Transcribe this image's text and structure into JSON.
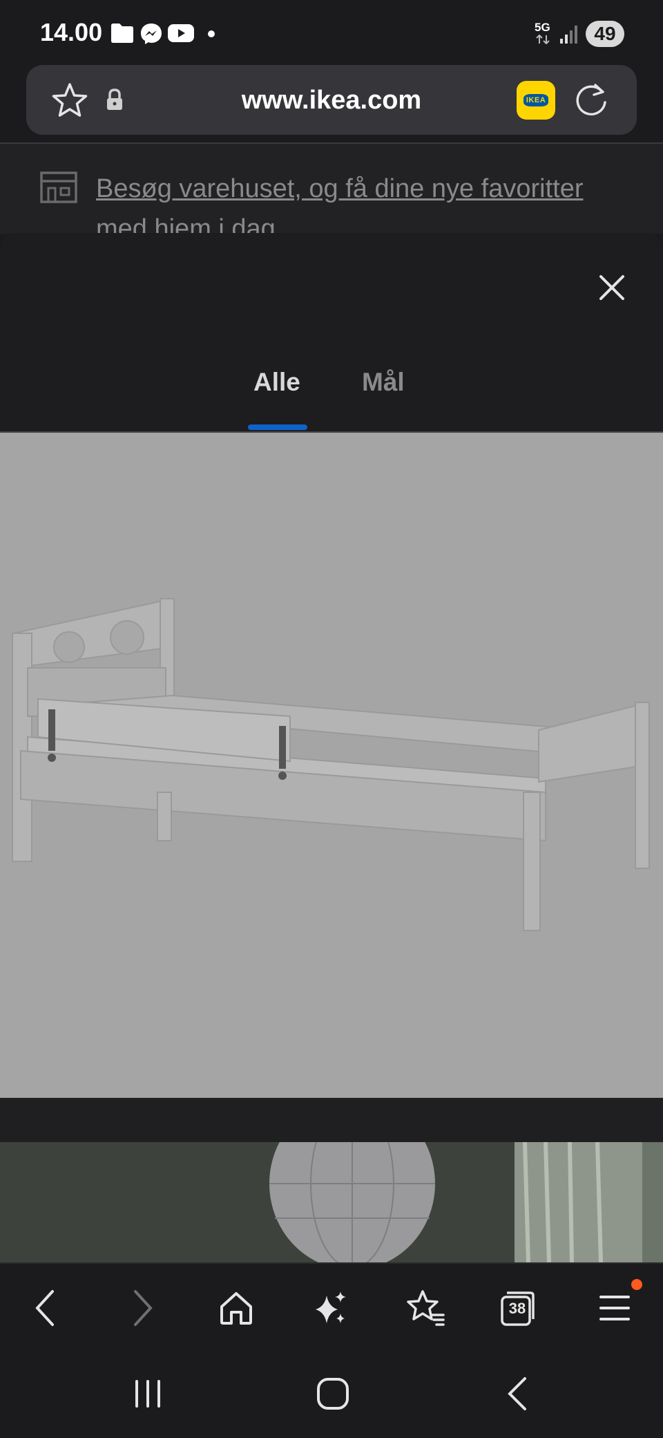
{
  "status_bar": {
    "time": "14.00",
    "network": "5G",
    "battery": "49",
    "icons": [
      "folder-icon",
      "messenger-icon",
      "youtube-icon",
      "dot-icon",
      "signal-icon"
    ]
  },
  "address_bar": {
    "url": "www.ikea.com",
    "icons": [
      "star-outline-icon",
      "lock-icon",
      "ikea-app-icon",
      "reload-icon"
    ],
    "ikea_logo_text": "IKEA"
  },
  "banner": {
    "text": "Besøg varehuset, og få dine nye favoritter med hjem i dag"
  },
  "gallery_sheet": {
    "tabs": [
      {
        "label": "Alle",
        "active": true
      },
      {
        "label": "Mål",
        "active": false
      }
    ],
    "accent_color": "#0f62c8"
  },
  "toolbar": {
    "buttons": [
      "back-icon",
      "forward-icon",
      "home-icon",
      "sparkle-icon",
      "bookmarks-icon",
      "tabs-icon",
      "menu-icon"
    ],
    "tabs_count": "38"
  },
  "system_nav": {
    "buttons": [
      "recents-icon",
      "home-circle-icon",
      "system-back-icon"
    ]
  }
}
